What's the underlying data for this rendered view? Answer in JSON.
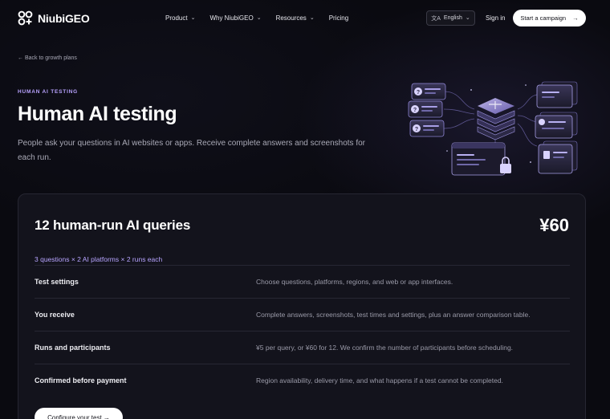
{
  "brand": {
    "name": "NiubiGEO",
    "logo_icon": "niubigeo-logo-icon"
  },
  "nav": {
    "items": [
      {
        "label": "Product",
        "has_dropdown": true
      },
      {
        "label": "Why NiubiGEO",
        "has_dropdown": true
      },
      {
        "label": "Resources",
        "has_dropdown": true
      },
      {
        "label": "Pricing",
        "has_dropdown": false
      }
    ],
    "language": "English",
    "language_icon": "translate-icon",
    "signin": "Sign in",
    "cta": "Start a campaign",
    "cta_icon": "arrow-right-icon"
  },
  "hero": {
    "back_link": "← Back to growth plans",
    "eyebrow": "HUMAN AI TESTING",
    "title": "Human AI testing",
    "description": "People ask your questions in AI websites or apps. Receive complete answers and screenshots for each run."
  },
  "card": {
    "title": "12 human-run AI queries",
    "price": "¥60",
    "subtitle": "3 questions × 2 AI platforms × 2 runs each",
    "rows": [
      {
        "label": "Test settings",
        "value": "Choose questions, platforms, regions, and web or app interfaces."
      },
      {
        "label": "You receive",
        "value": "Complete answers, screenshots, test times and settings, plus an answer comparison table."
      },
      {
        "label": "Runs and participants",
        "value": "¥5 per query, or ¥60 for 12. We confirm the number of participants before scheduling."
      },
      {
        "label": "Confirmed before payment",
        "value": "Region availability, delivery time, and what happens if a test cannot be completed."
      }
    ],
    "configure_button": "Configure your test →"
  },
  "colors": {
    "background": "#0a0a10",
    "card": "#13131c",
    "accent": "#b9a3ff",
    "cta": "#ffffff"
  }
}
